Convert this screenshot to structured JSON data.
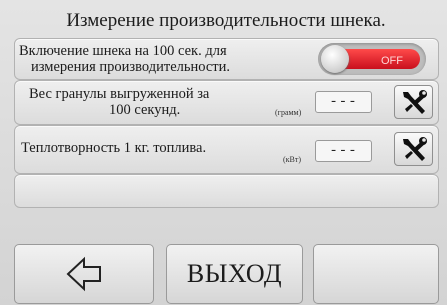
{
  "title": "Измерение производительности шнека.",
  "auger_row": {
    "label_line1": "Включение шнека на 100 сек. для",
    "label_line2": "измерения производительности.",
    "toggle_state": "OFF"
  },
  "pellet_row": {
    "label_line1": "Вес гранулы выгруженной за",
    "label_line2": "100 секунд.",
    "unit": "(грамм)",
    "value": "---",
    "settings_icon": "tools-icon"
  },
  "heat_row": {
    "label": "Теплотворность 1 кг. топлива.",
    "unit": "(кВт)",
    "value": "---",
    "settings_icon": "tools-icon"
  },
  "bottom_bar": {
    "back_icon": "arrow-left-icon",
    "exit_label": "ВЫХОД"
  },
  "colors": {
    "toggle_off": "#d11a24",
    "panel_bg": "#e6e6e6",
    "border": "#b2b2b2"
  }
}
